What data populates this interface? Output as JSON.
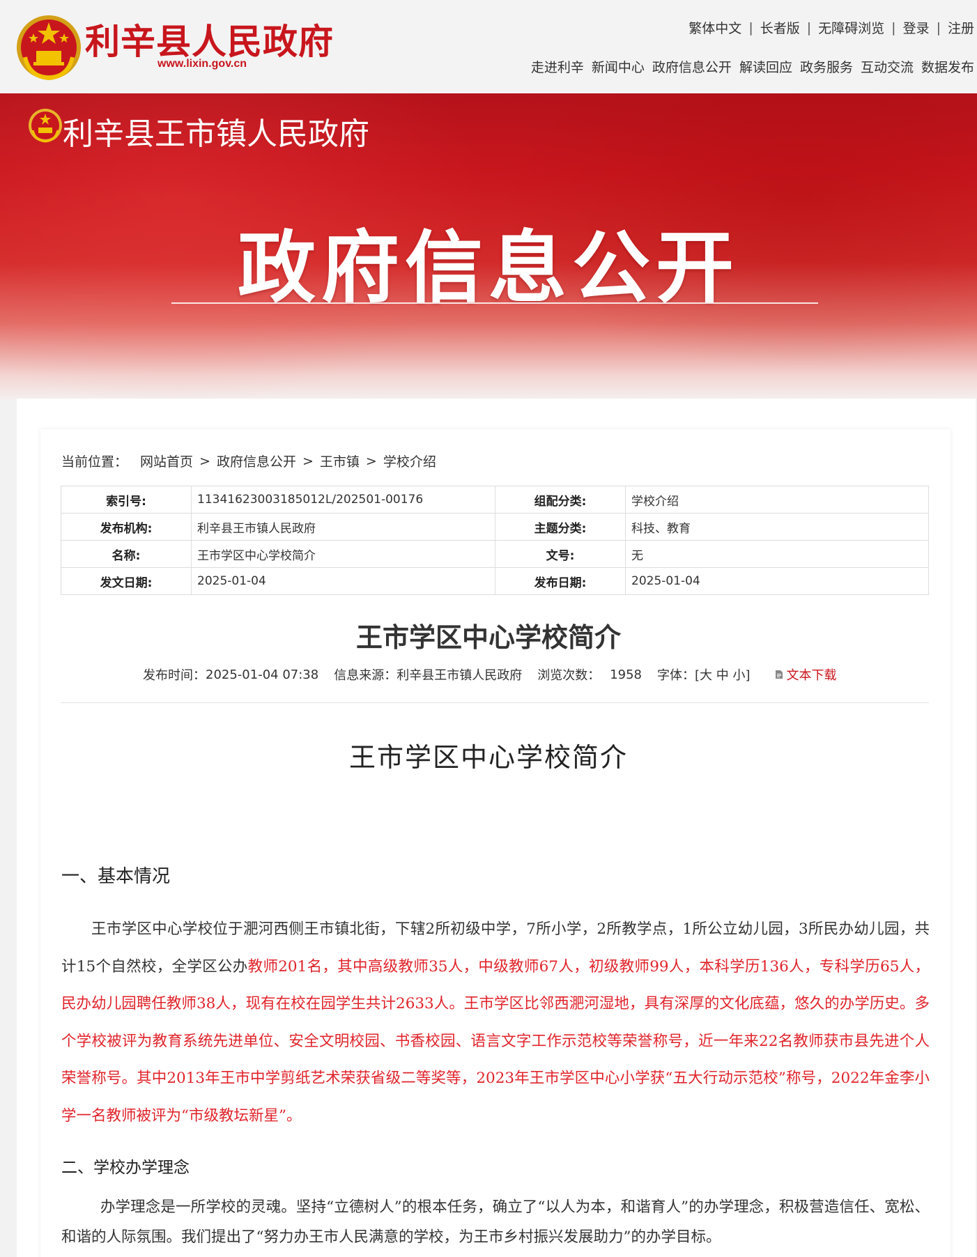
{
  "header": {
    "site_name": "利辛县人民政府",
    "site_url": "www.lixin.gov.cn",
    "util_links": [
      "繁体中文",
      "长者版",
      "无障碍浏览",
      "登录",
      "注册"
    ],
    "nav": [
      "走进利辛",
      "新闻中心",
      "政府信息公开",
      "解读回应",
      "政务服务",
      "互动交流",
      "数据发布"
    ]
  },
  "banner": {
    "town_name": "利辛县王市镇人民政府",
    "title": "政府信息公开"
  },
  "breadcrumb": {
    "label": "当前位置：",
    "items": [
      "网站首页",
      "政府信息公开",
      "王市镇",
      "学校介绍"
    ],
    "sep": ">"
  },
  "meta": {
    "rows": [
      {
        "k1": "索引号:",
        "v1": "11341623003185012L/202501-00176",
        "k2": "组配分类:",
        "v2": "学校介绍"
      },
      {
        "k1": "发布机构:",
        "v1": "利辛县王市镇人民政府",
        "k2": "主题分类:",
        "v2": "科技、教育"
      },
      {
        "k1": "名称:",
        "v1": "王市学区中心学校简介",
        "k2": "文号:",
        "v2": "无"
      },
      {
        "k1": "发文日期:",
        "v1": "2025-01-04",
        "k2": "发布日期:",
        "v2": "2025-01-04"
      }
    ]
  },
  "article": {
    "title": "王市学区中心学校简介",
    "publish_label": "发布时间：",
    "publish_time": "2025-01-04 07:38",
    "source_label": "信息来源：",
    "source": "利辛县王市镇人民政府",
    "views_label": "浏览次数：",
    "views": "1958",
    "font_label": "字体：",
    "font_sizes": "[大 中 小]",
    "download": "文本下载",
    "doc_title": "王市学区中心学校简介",
    "sec1": "一、基本情况",
    "para1_a": "王市学区中心学校位于淝河西侧王市镇北街，下辖2所初级中学，7所小学，2所教学点，1所公立幼儿园，3所民办幼儿园，共计15个自然校，全学区公办",
    "para1_b": "教师201名，其中高级教师35人，中级教师67人，初级教师99人，本科学历136人，专科学历65人，民办幼儿园聘任教师38人，现有在校在园学生共计2633人。王市学区比邻西淝河湿地，具有深厚的文化底蕴，悠久的办学历史。多个学校被评为教育系统先进单位、安全文明校园、书香校园、语言文字工作示范校等荣誉称号，近一年来22名教师获市县先进个人荣誉称号。其中2013年王市中学剪纸艺术荣获省级二等奖等，2023年王市学区中心小学获“五大行动示范校”称号，2022年金李小学一名教师被评为“市级教坛新星”。",
    "sec2": "二、学校办学理念",
    "para2": "办学理念是一所学校的灵魂。坚持“立德树人”的根本任务，确立了“以人为本，和谐育人”的办学理念，积极营造信任、宽松、和谐的人际氛围。我们提出了“努力办王市人民满意的学校，为王市乡村振兴发展助力”的办学目标。"
  },
  "colors": {
    "brand_red": "#c8161d",
    "highlight_red": "#e0242b"
  }
}
